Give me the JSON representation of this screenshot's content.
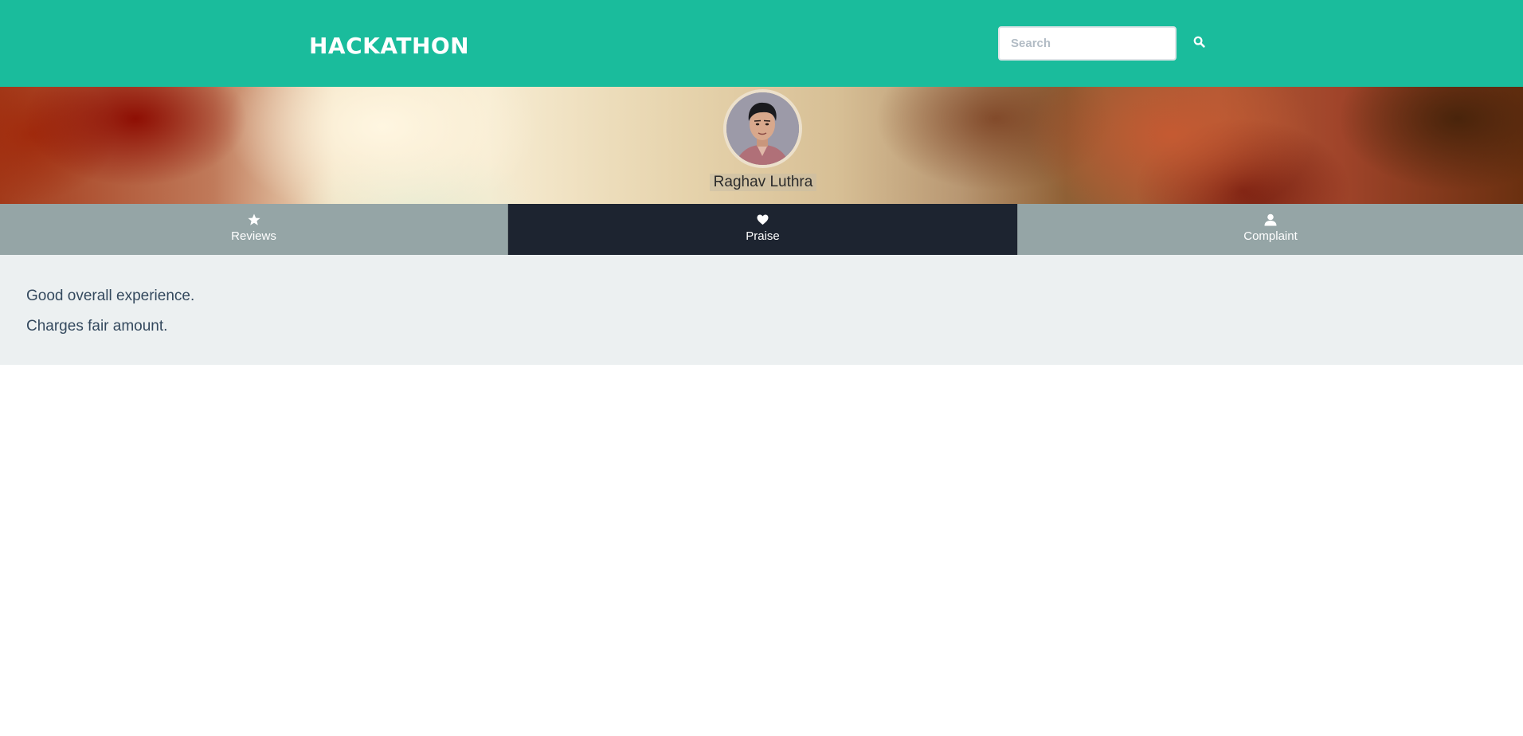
{
  "navbar": {
    "brand": "HACKATHON",
    "search_placeholder": "Search",
    "search_value": "",
    "search_icon": "search-icon",
    "background_color": "#1abc9c"
  },
  "profile": {
    "name": "Raghav Luthra",
    "avatar": "avatar-photo"
  },
  "tabs": [
    {
      "label": "Reviews",
      "icon": "star-icon",
      "active": false
    },
    {
      "label": "Praise",
      "icon": "heart-icon",
      "active": true
    },
    {
      "label": "Complaint",
      "icon": "user-icon",
      "active": false
    }
  ],
  "content": {
    "lines": [
      "Good overall experience.",
      "Charges fair amount."
    ]
  },
  "colors": {
    "accent": "#1abc9c",
    "tab_inactive": "#95a5a6",
    "tab_active": "#1d2430",
    "content_bg": "#ecf0f1",
    "text": "#34495e"
  }
}
